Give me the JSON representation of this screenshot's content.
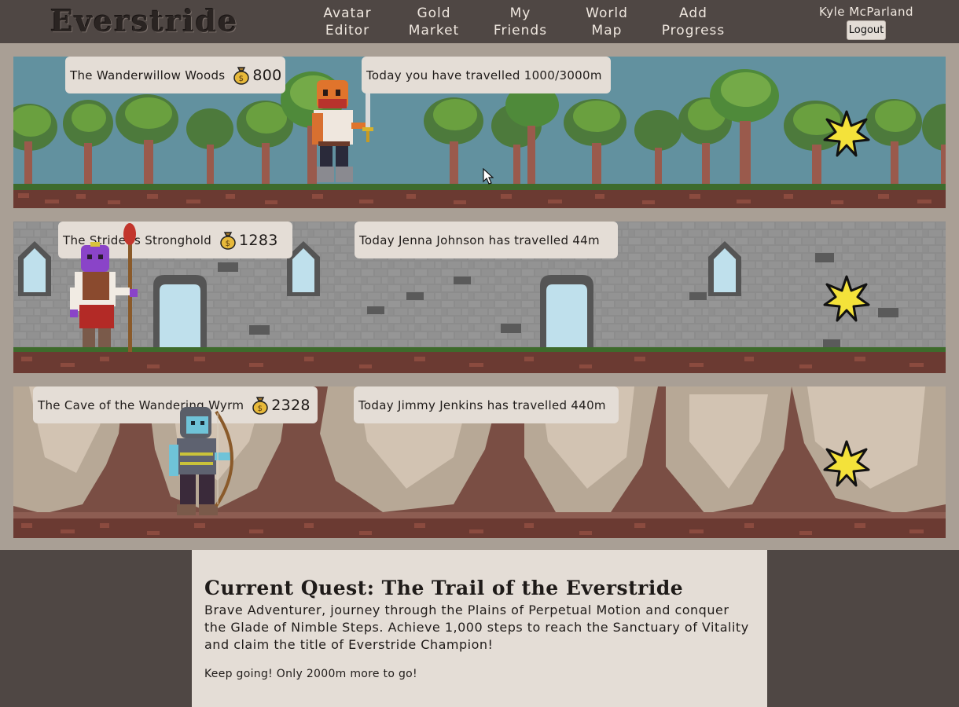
{
  "app": {
    "logo": "Everstride"
  },
  "nav": [
    {
      "line1": "Avatar",
      "line2": "Editor"
    },
    {
      "line1": "Gold",
      "line2": "Market"
    },
    {
      "line1": "My",
      "line2": "Friends"
    },
    {
      "line1": "World",
      "line2": "Map"
    },
    {
      "line1": "Add",
      "line2": "Progress"
    }
  ],
  "user": {
    "name": "Kyle McParland",
    "logout_label": "Logout"
  },
  "lanes": [
    {
      "location": "The Wanderwillow Woods",
      "gold": "800",
      "travel": "Today you have travelled 1000/3000m",
      "scene": "forest",
      "avatar": "swordsman",
      "icons": [
        "gold-bag-icon",
        "goal-star-icon"
      ]
    },
    {
      "location": "The Strider's Stronghold",
      "gold": "1283",
      "travel": "Today Jenna Johnson has travelled 44m",
      "scene": "castle",
      "avatar": "mage",
      "icons": [
        "gold-bag-icon",
        "goal-star-icon"
      ]
    },
    {
      "location": "The Cave of the Wandering Wyrm",
      "gold": "2328",
      "travel": "Today Jimmy Jenkins has travelled 440m",
      "scene": "cave",
      "avatar": "archer",
      "icons": [
        "gold-bag-icon",
        "goal-star-icon"
      ]
    }
  ],
  "quest": {
    "title": "Current Quest: The Trail of the Everstride",
    "body": "Brave Adventurer, journey through the Plains of Perpetual Motion and conquer the Glade of Nimble Steps. Achieve 1,000 steps to reach the Sanctuary of Vitality and claim the title of Everstride Champion!",
    "remaining": "Keep going! Only 2000m more to go!"
  },
  "colors": {
    "header_bg": "#4f4744",
    "band_bg": "#a99f95",
    "panel_bg": "#e4ddd6",
    "sky": "#62919f",
    "castle_wall": "#8a8a8a",
    "cave_wall": "#cfc2b2",
    "star_fill": "#f4e23a"
  }
}
